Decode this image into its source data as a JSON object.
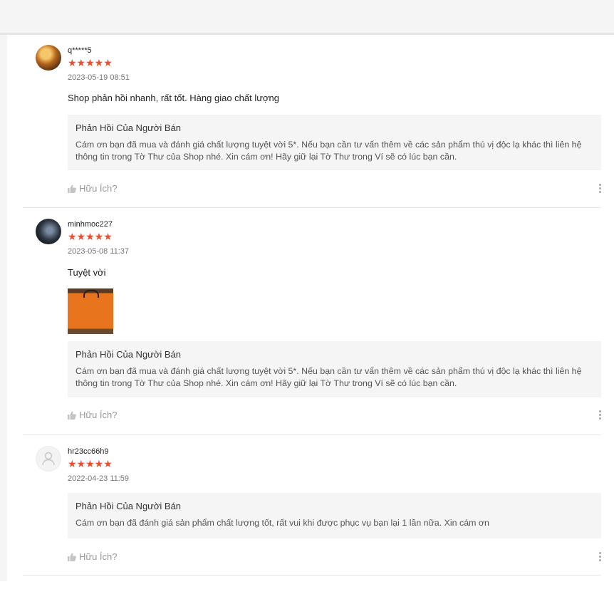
{
  "reviews": [
    {
      "username": "q*****5",
      "stars": "★★★★★",
      "rating": 5,
      "date": "2023-05-19 08:51",
      "comment": "Shop phản hồi nhanh, rất tốt. Hàng giao chất lượng",
      "seller_title": "Phản Hồi Của Người Bán",
      "seller_text": "Cám ơn bạn đã mua và đánh giá chất lượng tuyệt vời 5*. Nếu bạn cần tư vấn thêm về các sản phẩm thú vị độc lạ khác thì liên hệ thông tin trong Tờ Thư của Shop nhé. Xin cám ơn! Hãy giữ lại Tờ Thư trong Ví sẽ có lúc bạn cần.",
      "helpful_label": "Hữu Ích?"
    },
    {
      "username": "minhmoc227",
      "stars": "★★★★★",
      "rating": 5,
      "date": "2023-05-08 11:37",
      "comment": "Tuyệt vời",
      "seller_title": "Phản Hồi Của Người Bán",
      "seller_text": "Cám ơn bạn đã mua và đánh giá chất lượng tuyệt vời 5*. Nếu bạn cần tư vấn thêm về các sản phẩm thú vị độc lạ khác thì liên hệ thông tin trong Tờ Thư của Shop nhé. Xin cám ơn! Hãy giữ lại Tờ Thư trong Ví sẽ có lúc bạn cần.",
      "helpful_label": "Hữu Ích?"
    },
    {
      "username": "hr23cc66h9",
      "stars": "★★★★★",
      "rating": 5,
      "date": "2022-04-23 11:59",
      "seller_title": "Phản Hồi Của Người Bán",
      "seller_text": "Cám ơn bạn đã đánh giá sản phẩm chất lượng tốt, rất vui khi được phục vụ bạn lại 1 lần nữa. Xin cám ơn",
      "helpful_label": "Hữu Ích?"
    }
  ],
  "colors": {
    "star": "#ee4d2d",
    "seller_box": "#f5f5f5",
    "muted": "#999999"
  },
  "icons": {
    "helpful": "thumbs-up-icon",
    "more": "more-vertical-icon",
    "default_avatar": "user-icon"
  }
}
